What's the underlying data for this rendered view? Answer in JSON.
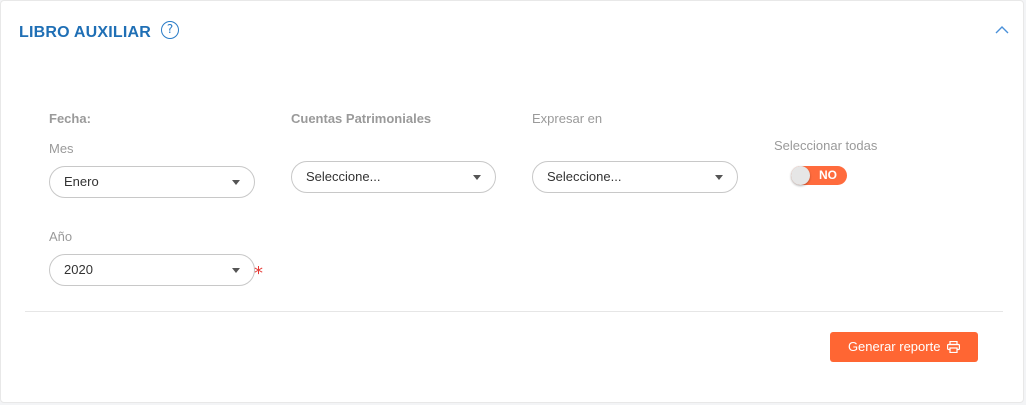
{
  "header": {
    "title": "LIBRO AUXILIAR",
    "help_icon": "question-circle-icon",
    "collapse_icon": "chevron-up-icon",
    "help_glyph": "?"
  },
  "filters": {
    "fecha_label": "Fecha:",
    "mes_label": "Mes",
    "mes_value": "Enero",
    "anio_label": "Año",
    "anio_value": "2020",
    "anio_required_mark": "*",
    "cuentas_label": "Cuentas Patrimoniales",
    "cuentas_value": "Seleccione...",
    "expresar_label": "Expresar en",
    "expresar_value": "Seleccione...",
    "seleccionar_label": "Seleccionar todas",
    "toggle_text": "NO"
  },
  "actions": {
    "generate_label": "Generar reporte",
    "generate_icon": "print-icon"
  },
  "colors": {
    "title": "#1f6fb5",
    "accent": "#ff6633",
    "required": "#e53935"
  }
}
